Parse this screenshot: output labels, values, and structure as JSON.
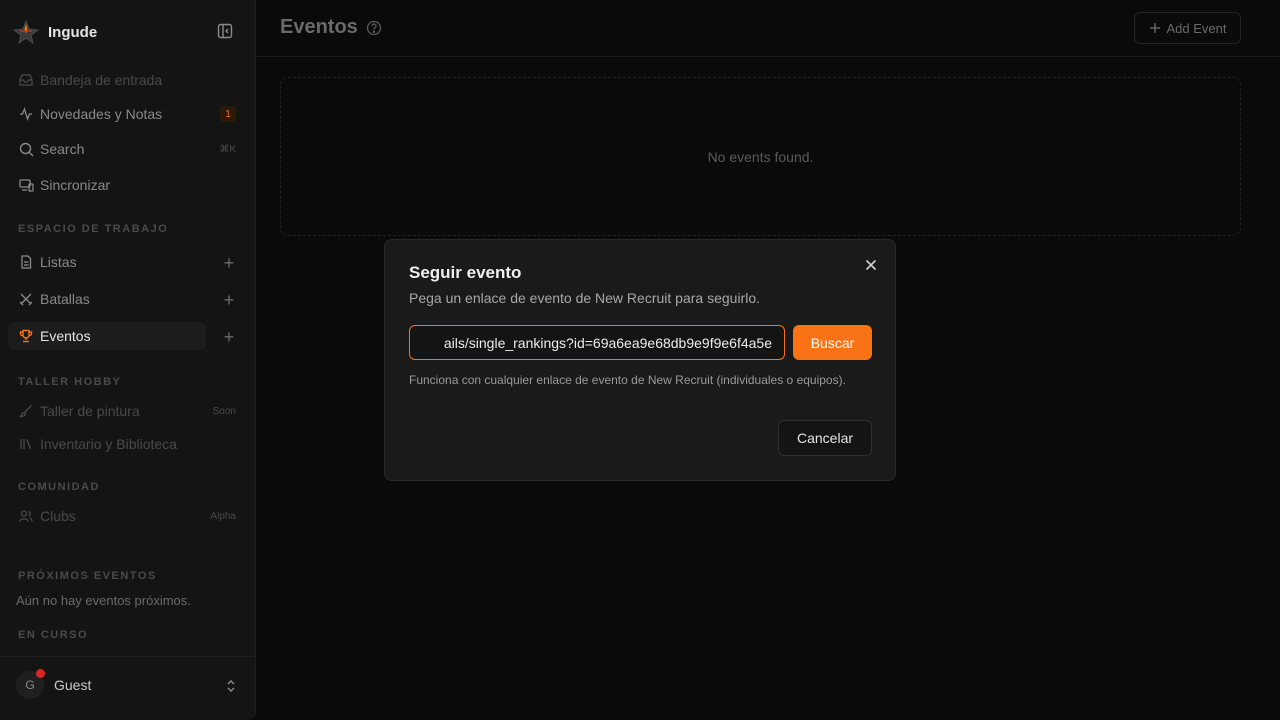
{
  "app": {
    "name": "Ingude"
  },
  "sidebar": {
    "nav": [
      {
        "label": "Bandeja de entrada",
        "icon": "inbox-icon"
      },
      {
        "label": "Novedades y Notas",
        "icon": "activity-icon",
        "badge": "1"
      },
      {
        "label": "Search",
        "icon": "search-icon",
        "shortcut": "⌘K"
      },
      {
        "label": "Sincronizar",
        "icon": "devices-icon"
      }
    ],
    "sections": {
      "workspace": "ESPACIO DE TRABAJO",
      "hobby": "TALLER HOBBY",
      "community": "COMUNIDAD",
      "upcoming": "PRÓXIMOS EVENTOS",
      "ongoing": "EN CURSO"
    },
    "workspace_items": [
      {
        "label": "Listas",
        "icon": "file-icon"
      },
      {
        "label": "Batallas",
        "icon": "swords-icon"
      },
      {
        "label": "Eventos",
        "icon": "trophy-icon"
      }
    ],
    "hobby_items": [
      {
        "label": "Taller de pintura",
        "icon": "brush-icon",
        "tag": "Soon"
      },
      {
        "label": "Inventario y Biblioteca",
        "icon": "library-icon"
      }
    ],
    "community_items": [
      {
        "label": "Clubs",
        "icon": "users-icon",
        "tag": "Alpha"
      }
    ],
    "upcoming_text": "Aún no hay eventos próximos.",
    "user": {
      "initial": "G",
      "name": "Guest"
    }
  },
  "main": {
    "title": "Eventos",
    "add_event_label": "Add Event",
    "empty_text": "No events found."
  },
  "modal": {
    "title": "Seguir evento",
    "description": "Pega un enlace de evento de New Recruit para seguirlo.",
    "input_value": "ails/single_rankings?id=69a6ea9e68db9e9f9e6f4a5e",
    "search_label": "Buscar",
    "hint": "Funciona con cualquier enlace de evento de New Recruit (individuales o equipos).",
    "cancel_label": "Cancelar"
  },
  "colors": {
    "accent": "#f97316",
    "background": "#0a0a0a",
    "sidebar": "#141414",
    "modal": "#1a1a1a"
  }
}
